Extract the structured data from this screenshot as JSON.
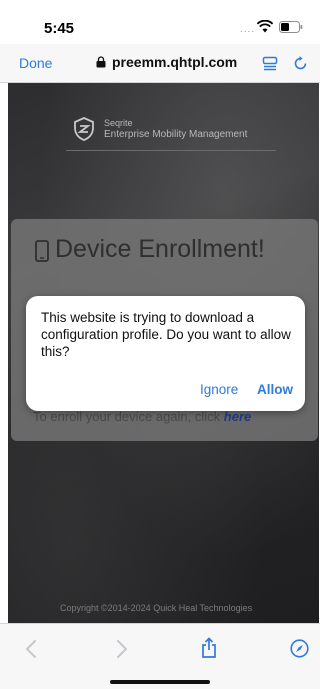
{
  "status_bar": {
    "time": "5:45",
    "signal_dots": "....",
    "icons": [
      "wifi-icon",
      "battery-icon"
    ]
  },
  "safari": {
    "done_label": "Done",
    "url": "preemm.qhtpl.com",
    "icons": [
      "lock-icon",
      "reader-icon",
      "reload-icon"
    ],
    "accent_color": "#2f7bdc"
  },
  "page": {
    "brand_name": "Seqrite",
    "brand_subtitle": "Enterprise Mobility Management",
    "enroll_title": "Device Enrollment!",
    "enroll_text": "To enroll your device again, click",
    "enroll_link": "here",
    "copyright": "Copyright ©2014-2024 Quick Heal Technologies"
  },
  "dialog": {
    "message": "This website is trying to download a configuration profile. Do you want to allow this?",
    "ignore_label": "Ignore",
    "allow_label": "Allow"
  },
  "bottom_bar": {
    "icons": [
      "back-icon",
      "forward-icon",
      "share-icon",
      "compass-icon"
    ]
  }
}
